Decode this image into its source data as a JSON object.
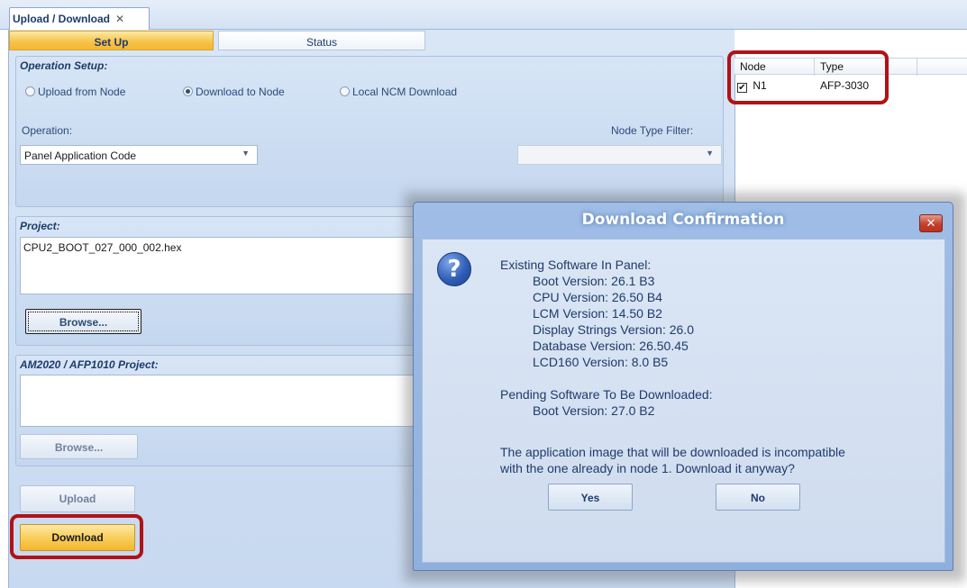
{
  "tabs": {
    "document_tab": "Upload / Download",
    "close_glyph": "✕"
  },
  "subtabs": {
    "setup": "Set Up",
    "status": "Status"
  },
  "operation_setup": {
    "title": "Operation Setup:",
    "radios": [
      {
        "label": "Upload from Node",
        "checked": false
      },
      {
        "label": "Download to Node",
        "checked": true
      },
      {
        "label": "Local NCM Download",
        "checked": false
      }
    ],
    "operation_label": "Operation:",
    "operation_value": "Panel Application Code",
    "node_type_filter_label": "Node Type Filter:",
    "node_type_filter_value": ""
  },
  "project": {
    "title": "Project:",
    "file": "CPU2_BOOT_027_000_002.hex",
    "browse_label": "Browse..."
  },
  "am_project": {
    "title": "AM2020 / AFP1010 Project:",
    "file": "",
    "browse_label": "Browse..."
  },
  "actions": {
    "upload_label": "Upload",
    "download_label": "Download"
  },
  "node_table": {
    "columns": [
      "Node",
      "Type"
    ],
    "rows": [
      {
        "checked": true,
        "node": "N1",
        "type": "AFP-3030"
      }
    ]
  },
  "dialog": {
    "title": "Download Confirmation",
    "close_glyph": "✕",
    "icon_glyph": "?",
    "existing_heading": "Existing Software In Panel:",
    "existing": [
      "Boot Version:  26.1 B3",
      "CPU Version:  26.50 B4",
      "LCM Version:  14.50 B2",
      "Display Strings Version: 26.0",
      "Database Version: 26.50.45",
      "LCD160 Version: 8.0 B5"
    ],
    "pending_heading": "Pending Software To Be Downloaded:",
    "pending": [
      "Boot Version:  27.0 B2"
    ],
    "warning_line1": "The application image that will be downloaded is incompatible",
    "warning_line2": "with the one already in node 1.  Download it anyway?",
    "yes_label": "Yes",
    "no_label": "No"
  },
  "colors": {
    "highlight": "#b01217",
    "accent_orange": "#f4b630",
    "panel_blue": "#c7d9f0",
    "dialog_blue": "#8fb0de"
  }
}
